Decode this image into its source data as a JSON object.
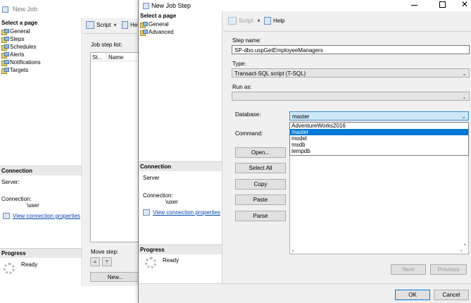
{
  "bg_window": {
    "title": "New Job",
    "select_a_page": "Select a page",
    "pages": [
      "General",
      "Steps",
      "Schedules",
      "Alerts",
      "Notifications",
      "Targets"
    ],
    "toolbar": {
      "script": "Script",
      "help": "Hel"
    },
    "job_step_list_label": "Job step list:",
    "col_step": "St...",
    "col_name": "Name",
    "connection": {
      "header": "Connection",
      "server_label": "Server:",
      "connection_label": "Connection:",
      "connection_value": "\\user",
      "view_link": "View connection properties"
    },
    "progress": {
      "header": "Progress",
      "status": "Ready"
    },
    "move_step_label": "Move step:",
    "new_button": "New..."
  },
  "dialog": {
    "title": "New Job Step",
    "select_a_page": "Select a page",
    "pages": [
      "General",
      "Advanced"
    ],
    "toolbar": {
      "script": "Script",
      "help": "Help"
    },
    "step_name_label": "Step name:",
    "step_name_value": "SP-dbo.uspGetEmployeeManagers",
    "type_label": "Type:",
    "type_value": "Transact-SQL script (T-SQL)",
    "run_as_label": "Run as:",
    "run_as_value": "",
    "database_label": "Database:",
    "database_value": "master",
    "database_options": [
      "AdventureWorks2016",
      "master",
      "model",
      "msdb",
      "tempdb"
    ],
    "database_selected_index": 1,
    "command_label": "Command:",
    "side_buttons": {
      "open": "Open...",
      "select_all": "Select All",
      "copy": "Copy",
      "paste": "Paste",
      "parse": "Parse"
    },
    "connection": {
      "header": "Connection",
      "server_label": "Server",
      "connection_label": "Connection:",
      "connection_value": "\\user",
      "view_link": "View connection properties"
    },
    "progress": {
      "header": "Progress",
      "status": "Ready"
    },
    "next_button": "Next",
    "previous_button": "Previous",
    "ok_button": "OK",
    "cancel_button": "Cancel"
  }
}
